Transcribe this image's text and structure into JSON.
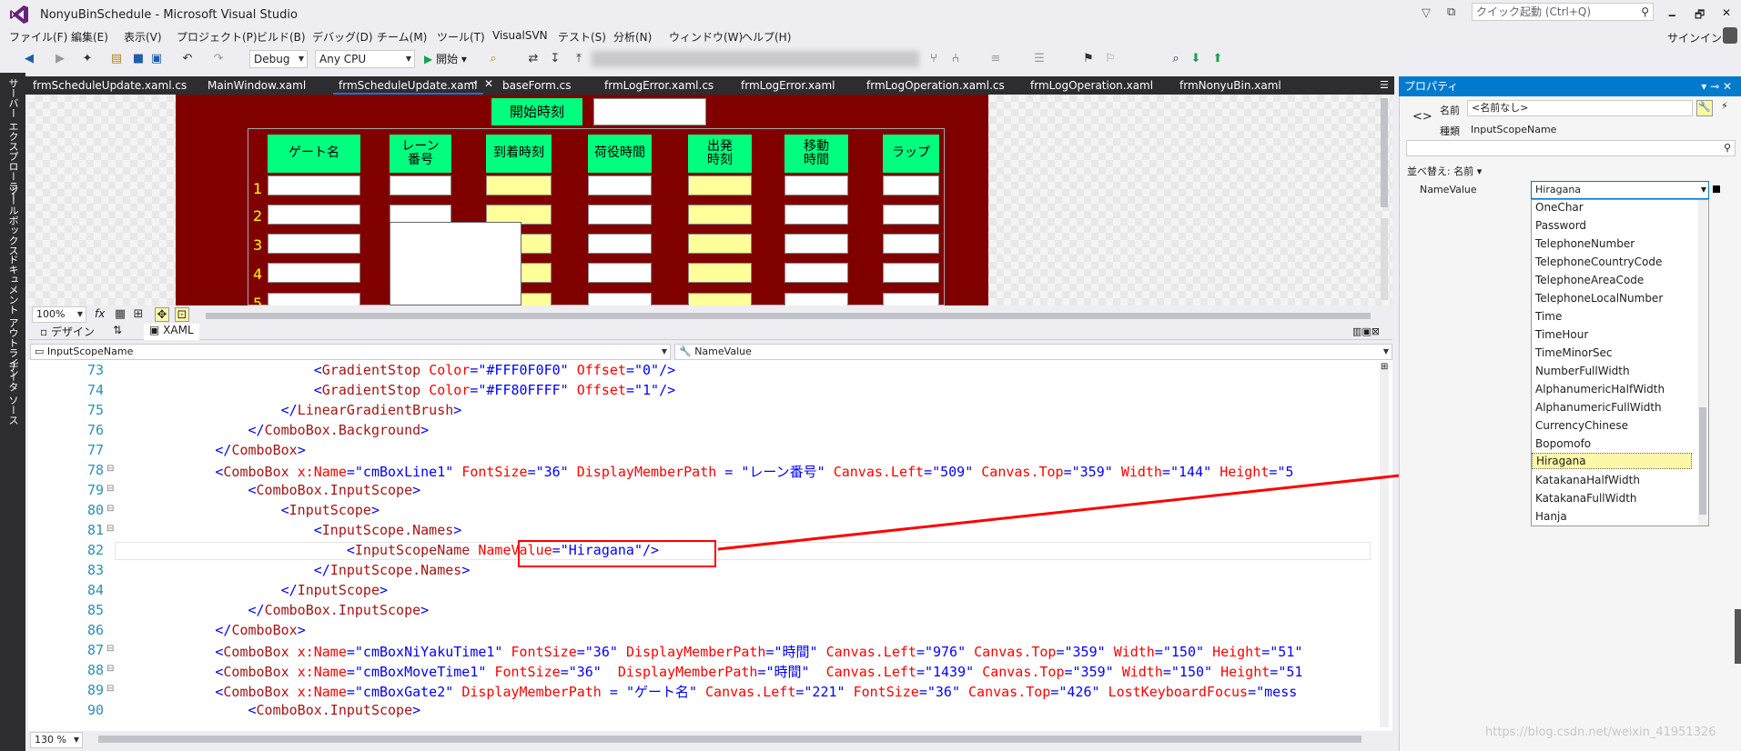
{
  "titlebar": {
    "title": "NonyuBinSchedule - Microsoft Visual Studio",
    "quick_launch": "クイック起動 (Ctrl+Q)",
    "minimize": "🗕",
    "maximize": "🗗",
    "close": "✕",
    "signin": "サインイン"
  },
  "menubar": {
    "items": [
      "ファイル(F)",
      "編集(E)",
      "表示(V)",
      "プロジェクト(P)",
      "ビルド(B)",
      "デバッグ(D)",
      "チーム(M)",
      "ツール(T)",
      "VisualSVN",
      "テスト(S)",
      "分析(N)",
      "ウィンドウ(W)",
      "ヘルプ(H)"
    ]
  },
  "toolbar": {
    "config": "Debug",
    "platform": "Any CPU",
    "start": "開始"
  },
  "side_tabs": [
    "サーバー エクスプローラー",
    "ツールボックス",
    "ドキュメント アウトライン",
    "データ ソース"
  ],
  "tabs": [
    "frmScheduleUpdate.xaml.cs",
    "MainWindow.xaml",
    "frmScheduleUpdate.xaml",
    "baseForm.cs",
    "frmLogError.xaml.cs",
    "frmLogError.xaml",
    "frmLogOperation.xaml.cs",
    "frmLogOperation.xaml",
    "frmNonyuBin.xaml"
  ],
  "designer": {
    "start_time_label": "開始時刻",
    "headers": [
      "ゲート名",
      "レーン\n番号",
      "到着時刻",
      "荷役時間",
      "出発\n時刻",
      "移動\n時間",
      "ラップ"
    ],
    "row_numbers": [
      "1",
      "2",
      "3",
      "4",
      "5"
    ],
    "zoom": "100%",
    "fx": "fx"
  },
  "design_tabs": {
    "design": "デザイン",
    "swap": "⇅",
    "xaml": "XAML"
  },
  "navbar": {
    "left": "InputScopeName",
    "right": "NameValue"
  },
  "editor": {
    "line_numbers": [
      "73",
      "74",
      "75",
      "76",
      "77",
      "78",
      "79",
      "80",
      "81",
      "82",
      "83",
      "84",
      "85",
      "86",
      "87",
      "88",
      "89",
      "90"
    ],
    "lines": [
      "                        <GradientStop Color=\"#FFF0F0F0\" Offset=\"0\"/>",
      "                        <GradientStop Color=\"#FF80FFFF\" Offset=\"1\"/>",
      "                    </LinearGradientBrush>",
      "                </ComboBox.Background>",
      "            </ComboBox>",
      "            <ComboBox x:Name=\"cmBoxLine1\" FontSize=\"36\" DisplayMemberPath = \"レーン番号\" Canvas.Left=\"509\" Canvas.Top=\"359\" Width=\"144\" Height=\"5",
      "                <ComboBox.InputScope>",
      "                    <InputScope>",
      "                        <InputScope.Names>",
      "                            <InputScopeName NameValue=\"Hiragana\"/>",
      "                        </InputScope.Names>",
      "                    </InputScope>",
      "                </ComboBox.InputScope>",
      "            </ComboBox>",
      "            <ComboBox x:Name=\"cmBoxNiYakuTime1\" FontSize=\"36\" DisplayMemberPath=\"時間\" Canvas.Left=\"976\" Canvas.Top=\"359\" Width=\"150\" Height=\"51\"",
      "            <ComboBox x:Name=\"cmBoxMoveTime1\" FontSize=\"36\"  DisplayMemberPath=\"時間\"  Canvas.Left=\"1439\" Canvas.Top=\"359\" Width=\"150\" Height=\"51",
      "            <ComboBox x:Name=\"cmBoxGate2\" DisplayMemberPath = \"ゲート名\" Canvas.Left=\"221\" FontSize=\"36\" Canvas.Top=\"426\" LostKeyboardFocus=\"mess",
      "                <ComboBox.InputScope>"
    ],
    "zoom": "130 %"
  },
  "properties": {
    "title": "プロパティ",
    "name_label": "名前",
    "name_value": "<名前なし>",
    "type_label": "種類",
    "type_value": "InputScopeName",
    "sort_label": "並べ替え: 名前",
    "prop_name": "NameValue",
    "prop_value": "Hiragana",
    "options": [
      "OneChar",
      "Password",
      "TelephoneNumber",
      "TelephoneCountryCode",
      "TelephoneAreaCode",
      "TelephoneLocalNumber",
      "Time",
      "TimeHour",
      "TimeMinorSec",
      "NumberFullWidth",
      "AlphanumericHalfWidth",
      "AlphanumericFullWidth",
      "CurrencyChinese",
      "Bopomofo",
      "Hiragana",
      "KatakanaHalfWidth",
      "KatakanaFullWidth",
      "Hanja"
    ],
    "selected": "Hiragana"
  },
  "watermark": "https://blog.csdn.net/weixin_41951326",
  "colors": {
    "accent": "#007acc",
    "maroon": "#800000",
    "green": "#00ff7f",
    "yellow": "#ffff99",
    "annotation": "#ff0000"
  }
}
